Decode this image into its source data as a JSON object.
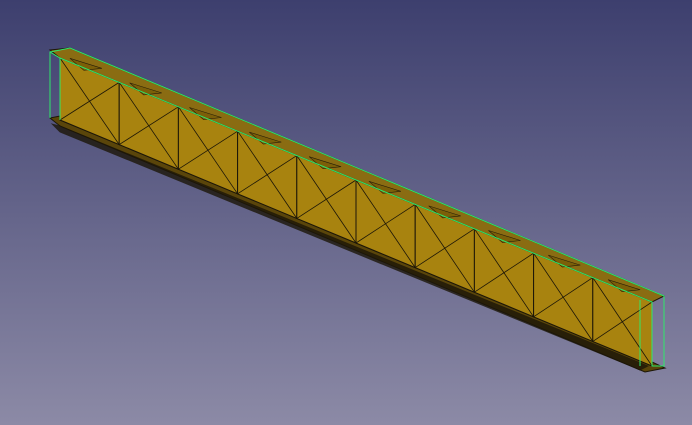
{
  "viewport": {
    "background_top": "#3d3f6e",
    "background_bottom": "#8c8aa6"
  },
  "model": {
    "panel_count": 10,
    "face_color": "#a8830f",
    "face_color_dark": "#7a5e08",
    "flange_top_color": "#8a6c12",
    "flange_bottom_color": "#5a450a",
    "edge_color": "#1c1608",
    "highlight_color": "#2ee86a"
  }
}
